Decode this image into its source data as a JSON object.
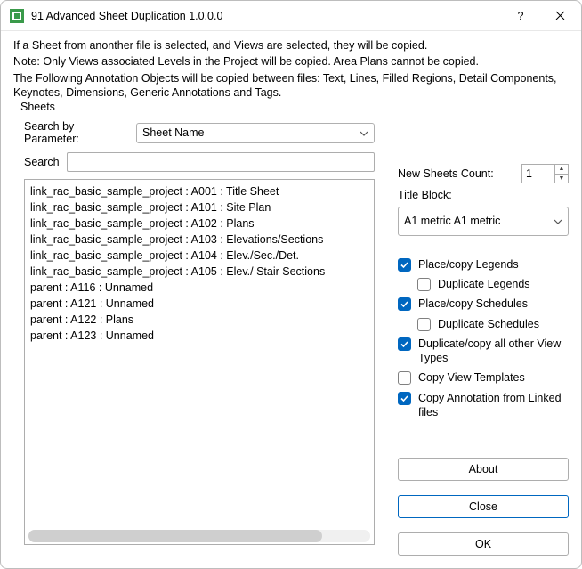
{
  "window": {
    "title": "91 Advanced Sheet Duplication 1.0.0.0",
    "help": "?",
    "close": "✕"
  },
  "description": {
    "line1": "If a Sheet from anonther file is selected, and Views are selected, they will be copied.",
    "line2": "Note: Only Views associated Levels in the Project will be copied. Area Plans cannot be copied.",
    "line3": "The Following Annotation Objects will be copied between files: Text, Lines, Filled Regions, Detail Components, Keynotes, Dimensions, Generic Annotations and Tags."
  },
  "sheets": {
    "group_label": "Sheets",
    "search_by_label": "Search by Parameter:",
    "search_by_value": "Sheet Name",
    "search_label": "Search",
    "search_value": "",
    "items": [
      "link_rac_basic_sample_project : A001 : Title Sheet",
      "link_rac_basic_sample_project : A101 : Site Plan",
      "link_rac_basic_sample_project : A102 : Plans",
      "link_rac_basic_sample_project : A103 : Elevations/Sections",
      "link_rac_basic_sample_project : A104 : Elev./Sec./Det.",
      "link_rac_basic_sample_project : A105 : Elev./ Stair Sections",
      "parent : A116 : Unnamed",
      "parent : A121 : Unnamed",
      "parent : A122 : Plans",
      "parent : A123 : Unnamed"
    ]
  },
  "options": {
    "new_sheets_count_label": "New Sheets Count:",
    "new_sheets_count_value": "1",
    "title_block_label": "Title Block:",
    "title_block_value": "A1 metric A1 metric",
    "place_legends": "Place/copy Legends",
    "duplicate_legends": "Duplicate Legends",
    "place_schedules": "Place/copy Schedules",
    "duplicate_schedules": "Duplicate Schedules",
    "duplicate_other": "Duplicate/copy all other View Types",
    "copy_templates": "Copy View Templates",
    "copy_annotation": "Copy Annotation from Linked files"
  },
  "buttons": {
    "about": "About",
    "close": "Close",
    "ok": "OK"
  }
}
